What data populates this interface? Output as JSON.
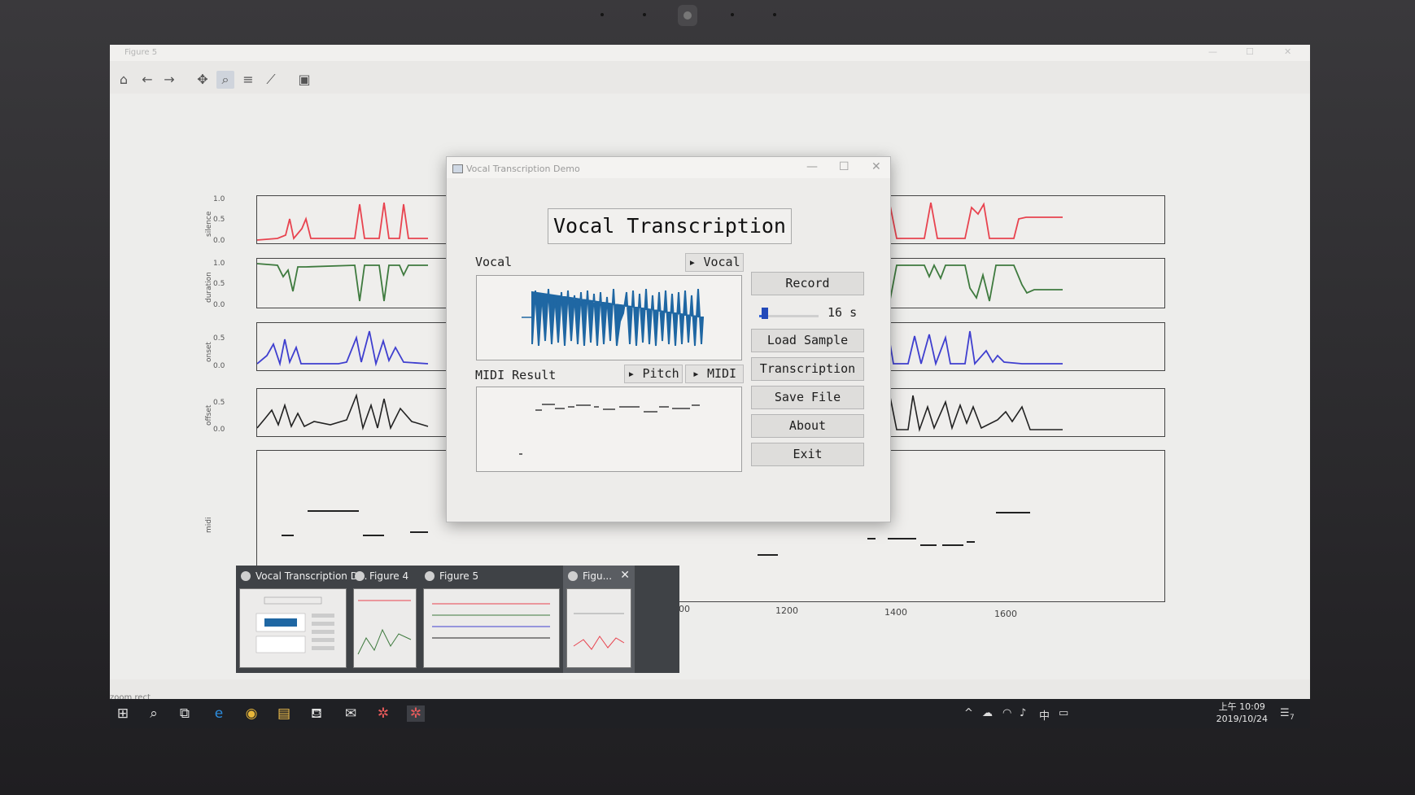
{
  "matplotlib": {
    "window_title": "Figure 5",
    "toolbar_icons": [
      "home-icon",
      "back-icon",
      "forward-icon",
      "pan-icon",
      "zoom-icon",
      "subplots-icon",
      "edit-axes-icon",
      "save-icon"
    ],
    "axes": [
      {
        "ylabel": "silence",
        "ticks": [
          "1.0",
          "0.5",
          "0.0"
        ],
        "color": "#e8434f"
      },
      {
        "ylabel": "duration",
        "ticks": [
          "1.0",
          "0.5",
          "0.0"
        ],
        "color": "#3e7a3e"
      },
      {
        "ylabel": "onset",
        "ticks": [
          "0.5",
          "0.0"
        ],
        "color": "#3f3fcf"
      },
      {
        "ylabel": "offset",
        "ticks": [
          "0.5",
          "0.0"
        ],
        "color": "#222222"
      },
      {
        "ylabel": "midi",
        "ticks": [],
        "color": "#222222"
      }
    ],
    "x_ticks": [
      "1000",
      "1200",
      "1400",
      "1600"
    ],
    "status": "zoom rect"
  },
  "dialog": {
    "window_title": "Vocal Transcription Demo",
    "app_title": "Vocal Transcription",
    "vocal_label": "Vocal",
    "vocal_play": "▸ Vocal",
    "midi_label": "MIDI Result",
    "pitch_play": "▸ Pitch",
    "midi_play": "▸ MIDI",
    "buttons": {
      "record": "Record",
      "load_sample": "Load Sample",
      "transcription": "Transcription",
      "save_file": "Save File",
      "about": "About",
      "exit": "Exit"
    },
    "duration": "16 s",
    "duration_slider_fraction": 0.1,
    "waveform_color": "#1f67a3"
  },
  "thumbnails": [
    {
      "title": "Vocal Transcription D..."
    },
    {
      "title": "Figure 4"
    },
    {
      "title": "Figure 5"
    },
    {
      "title": "Figu..."
    }
  ],
  "taskbar": {
    "time": "上午 10:09",
    "date": "2019/10/24",
    "ime": "中",
    "notification_count": "7"
  }
}
